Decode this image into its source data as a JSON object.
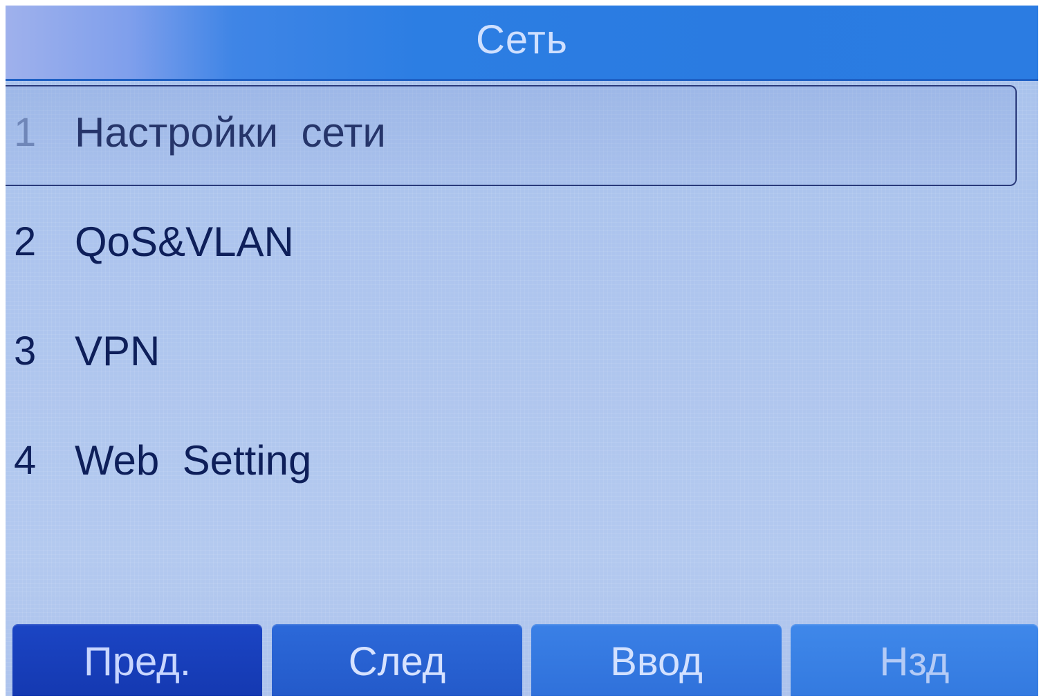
{
  "header": {
    "title": "Сеть"
  },
  "menu": {
    "items": [
      {
        "num": "1",
        "label": "Настройки  сети",
        "selected": true
      },
      {
        "num": "2",
        "label": "QoS&VLAN",
        "selected": false
      },
      {
        "num": "3",
        "label": "VPN",
        "selected": false
      },
      {
        "num": "4",
        "label": "Web  Setting",
        "selected": false
      }
    ]
  },
  "softkeys": {
    "prev": "Пред.",
    "next": "След",
    "enter": "Ввод",
    "back": "Нзд"
  },
  "colors": {
    "title_bar": "#2b7ce2",
    "background": "#aec5ee",
    "text": "#0e1f5a",
    "softkey_dark": "#1b45c4"
  }
}
